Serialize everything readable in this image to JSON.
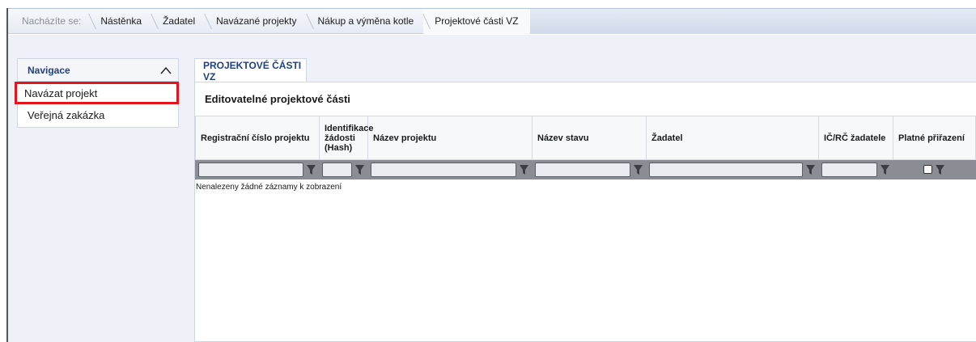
{
  "breadcrumb": {
    "prefix": "Nacházíte se:",
    "items": [
      {
        "label": "Nástěnka"
      },
      {
        "label": "Žadatel"
      },
      {
        "label": "Navázané projekty"
      },
      {
        "label": "Nákup a výměna kotle"
      },
      {
        "label": "Projektové části VZ"
      }
    ]
  },
  "navigation": {
    "title": "Navigace",
    "items": [
      {
        "label": "Navázat projekt",
        "highlighted": true
      },
      {
        "label": "Veřejná zakázka",
        "highlighted": false
      }
    ]
  },
  "tab": {
    "label": "PROJEKTOVÉ ČÁSTI VZ"
  },
  "section": {
    "title": "Editovatelné projektové části"
  },
  "table": {
    "columns": [
      {
        "label": "Registrační číslo projektu"
      },
      {
        "label": "Identifikace žádosti (Hash)"
      },
      {
        "label": "Název projektu"
      },
      {
        "label": "Název stavu"
      },
      {
        "label": "Žadatel"
      },
      {
        "label": "IČ/RČ žadatele"
      },
      {
        "label": "Platné přiřazení"
      }
    ],
    "empty_message": "Nenalezeny žádné záznamy k zobrazení"
  },
  "colors": {
    "accent": "#1f3f86",
    "highlight_border": "#e3151a",
    "filter_bar": "#8a8e94"
  }
}
